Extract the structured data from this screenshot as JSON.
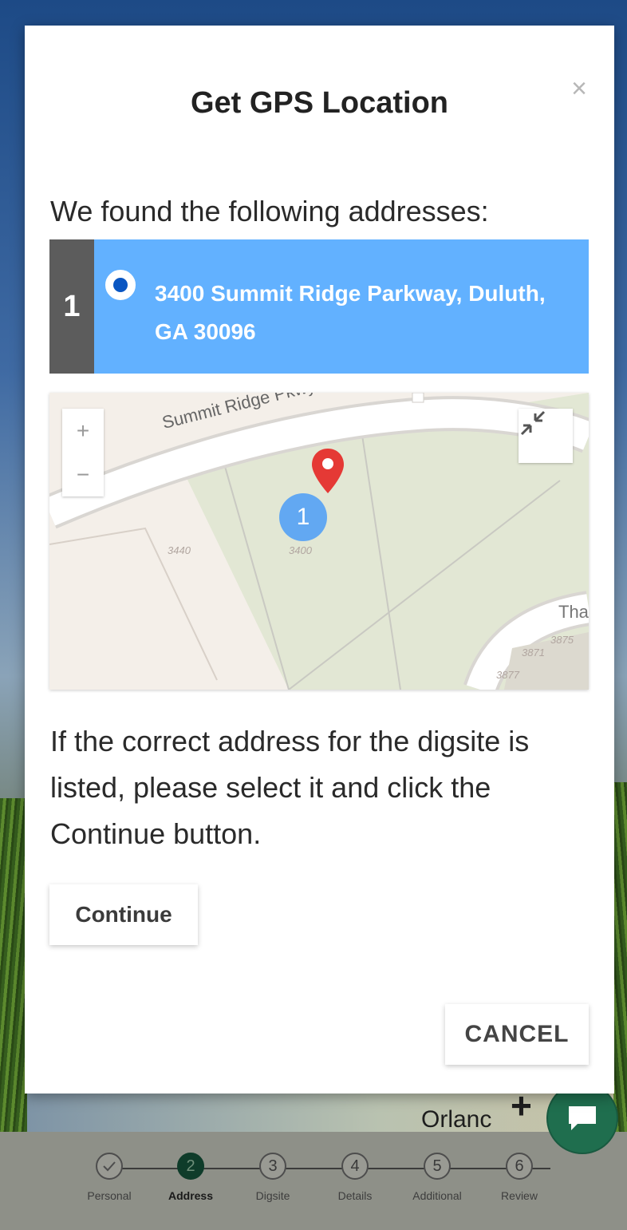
{
  "modal": {
    "title": "Get GPS Location",
    "close_glyph": "×",
    "found_text": "We found the following addresses:",
    "addresses": [
      {
        "index": "1",
        "text": "3400 Summit Ridge Parkway, Duluth, GA 30096",
        "selected": true
      }
    ],
    "instructions": "If the correct address for the digsite is listed, please select it and click the Continue button.",
    "continue_label": "Continue",
    "cancel_label": "CANCEL"
  },
  "map": {
    "zoom_in": "+",
    "zoom_out": "−",
    "street_label": "Summit Ridge Pkwy",
    "cluster_label": "1",
    "parcel_labels": [
      "3440",
      "3400",
      "3871",
      "3875",
      "3877"
    ],
    "partial_street": "Tha",
    "pin_color": "#e53935"
  },
  "background": {
    "city_label": "Orlanc",
    "zoom_plus": "+"
  },
  "stepper": {
    "steps": [
      {
        "number": "",
        "label": "Personal",
        "state": "done"
      },
      {
        "number": "2",
        "label": "Address",
        "state": "active"
      },
      {
        "number": "3",
        "label": "Digsite",
        "state": "pending"
      },
      {
        "number": "4",
        "label": "Details",
        "state": "pending"
      },
      {
        "number": "5",
        "label": "Additional",
        "state": "pending"
      },
      {
        "number": "6",
        "label": "Review",
        "state": "pending"
      }
    ]
  },
  "colors": {
    "address_highlight": "#62b1ff",
    "index_bar": "#5c5c5c",
    "chat_fab": "#1f6e4e",
    "radio_dot": "#0a56c2"
  },
  "icons": {
    "close": "close-icon",
    "fullscreen": "collapse-fullscreen-icon",
    "pin": "map-pin-icon",
    "chat": "chat-icon",
    "check": "checkmark-icon"
  }
}
